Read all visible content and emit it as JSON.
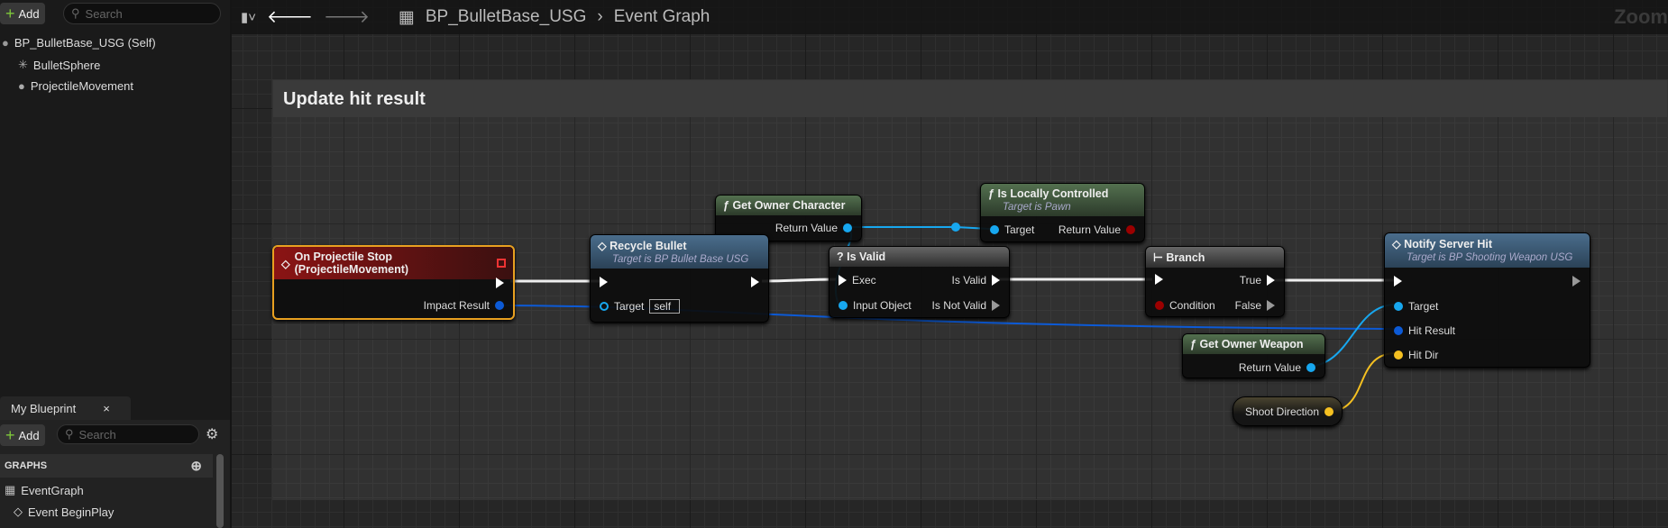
{
  "components": {
    "add_label": "Add",
    "search_placeholder": "Search",
    "items": [
      {
        "label": "BP_BulletBase_USG (Self)"
      },
      {
        "label": "BulletSphere"
      },
      {
        "label": "ProjectileMovement"
      }
    ]
  },
  "my_blueprint": {
    "tab_label": "My Blueprint",
    "close": "×",
    "add_label": "Add",
    "search_placeholder": "Search",
    "section": "GRAPHS",
    "items": [
      {
        "label": "EventGraph"
      },
      {
        "label": "Event BeginPlay"
      }
    ]
  },
  "toolbar": {
    "breadcrumb": [
      "BP_BulletBase_USG",
      "Event Graph"
    ],
    "zoom_label": "Zoom"
  },
  "comment": {
    "title": "Update hit result"
  },
  "nodes": {
    "on_projectile_stop": {
      "title": "On Projectile Stop (ProjectileMovement)",
      "pins": {
        "impact": "Impact Result"
      }
    },
    "recycle_bullet": {
      "title": "Recycle Bullet",
      "subtitle": "Target is BP Bullet Base USG",
      "pins": {
        "target": "Target",
        "target_value": "self"
      }
    },
    "get_owner_character": {
      "title": "Get Owner Character",
      "pins": {
        "ret": "Return Value"
      }
    },
    "is_valid": {
      "title": "Is Valid",
      "pins": {
        "exec": "Exec",
        "input": "Input Object",
        "valid": "Is Valid",
        "not_valid": "Is Not Valid"
      }
    },
    "is_locally_controlled": {
      "title": "Is Locally Controlled",
      "subtitle": "Target is Pawn",
      "pins": {
        "target": "Target",
        "ret": "Return Value"
      }
    },
    "branch": {
      "title": "Branch",
      "pins": {
        "condition": "Condition",
        "true": "True",
        "false": "False"
      }
    },
    "notify_server_hit": {
      "title": "Notify Server Hit",
      "subtitle": "Target is BP Shooting Weapon USG",
      "pins": {
        "target": "Target",
        "hit_result": "Hit Result",
        "hit_dir": "Hit Dir"
      }
    },
    "get_owner_weapon": {
      "title": "Get Owner Weapon",
      "pins": {
        "ret": "Return Value"
      }
    },
    "shoot_direction": {
      "title": "Shoot Direction"
    }
  },
  "colors": {
    "object_pin": "#17a7ef",
    "struct_pin": "#0c5ad6",
    "bool_pin": "#9b0000",
    "vector_pin": "#f5c021",
    "event_header": "#8b1414",
    "selection": "#e8a020"
  }
}
